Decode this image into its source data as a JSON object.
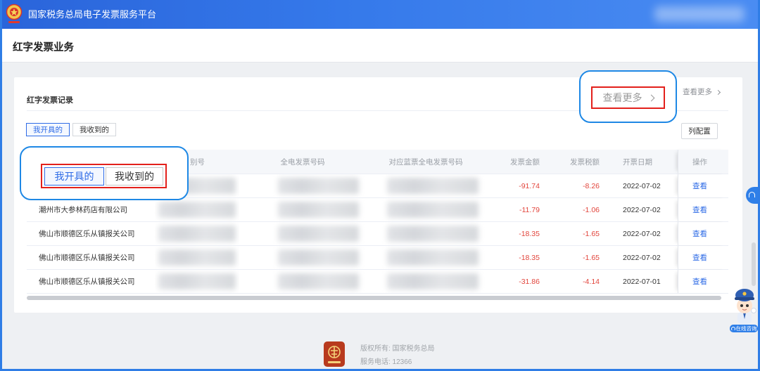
{
  "header": {
    "title": "国家税务总局电子发票服务平台"
  },
  "page": {
    "title": "红字发票业务"
  },
  "records": {
    "title": "红字发票记录",
    "more_label": "查看更多",
    "tabs": [
      {
        "label": "我开具的",
        "active": true
      },
      {
        "label": "我收到的",
        "active": false
      }
    ],
    "column_config_label": "列配置",
    "columns": {
      "tax_id": "别号",
      "invoice_no": "全电发票号码",
      "blue_invoice_no": "对应蓝票全电发票号码",
      "amount": "发票金额",
      "tax_amount": "发票税额",
      "issue_date": "开票日期",
      "action": "操作"
    },
    "rows": [
      {
        "amount": "-91.74",
        "tax_amount": "-8.26",
        "issue_date": "2022-07-02",
        "action": "查看"
      },
      {
        "name": "潮州市大参林药店有限公司",
        "amount": "-11.79",
        "tax_amount": "-1.06",
        "issue_date": "2022-07-02",
        "action": "查看"
      },
      {
        "name": "佛山市顺德区乐从镇报关公司",
        "amount": "-18.35",
        "tax_amount": "-1.65",
        "issue_date": "2022-07-02",
        "action": "查看"
      },
      {
        "name": "佛山市顺德区乐从镇报关公司",
        "amount": "-18.35",
        "tax_amount": "-1.65",
        "issue_date": "2022-07-02",
        "action": "查看"
      },
      {
        "name": "佛山市顺德区乐从镇报关公司",
        "amount": "-31.86",
        "tax_amount": "-4.14",
        "issue_date": "2022-07-01",
        "action": "查看"
      }
    ]
  },
  "callouts": {
    "more_label": "查看更多",
    "tabs": [
      "我开具的",
      "我收到的"
    ]
  },
  "assistant": {
    "label": "在线咨询"
  },
  "footer": {
    "copyright": "版权所有: 国家税务总局",
    "phone": "服务电话: 12366"
  },
  "icons": {
    "header_logo": "tax-emblem-icon",
    "more": "chevron-right-icon",
    "side_help": "headset-icon",
    "assistant": "police-mascot-icon",
    "footer_logo": "tax-bureau-emblem-icon"
  },
  "colors": {
    "frame_blue": "#2f7de6",
    "accent": "#2e6be6",
    "negative": "#e2453c",
    "callout_outline": "#1e88e5",
    "callout_highlight": "#e3201b",
    "assistant_blue": "#2f7fe8"
  }
}
